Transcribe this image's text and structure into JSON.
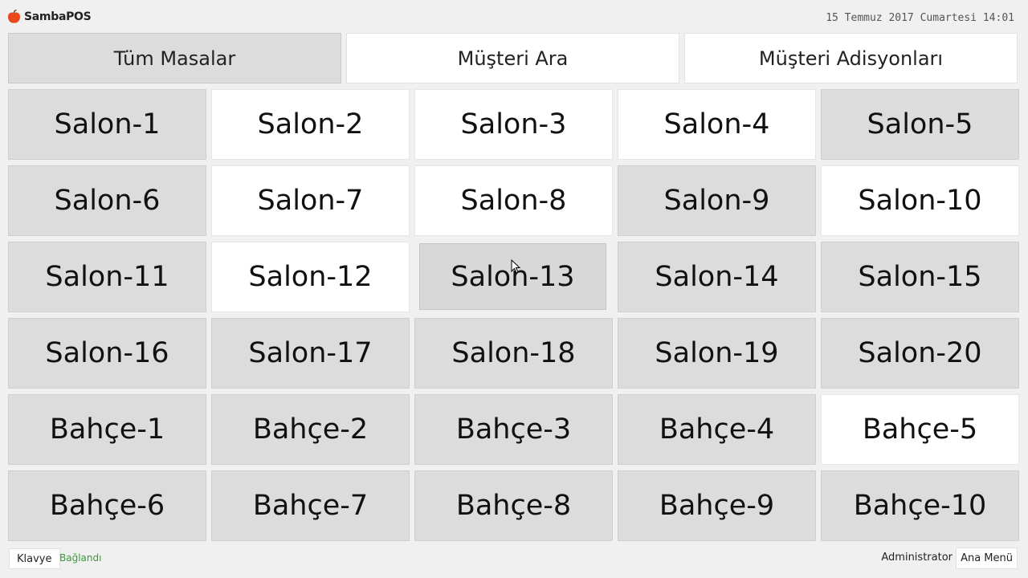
{
  "app": {
    "name": "SambaPOS",
    "datetime": "15 Temmuz 2017 Cumartesi 14:01",
    "logo_icon": "apple-logo-icon",
    "accent_color": "#e8481c"
  },
  "categories": [
    {
      "label": "Tüm Masalar",
      "state": "active"
    },
    {
      "label": "Müşteri Ara",
      "state": "inactive"
    },
    {
      "label": "Müşteri Adisyonları",
      "state": "inactive"
    }
  ],
  "tables": [
    {
      "label": "Salon-1",
      "state": "gray"
    },
    {
      "label": "Salon-2",
      "state": "white"
    },
    {
      "label": "Salon-3",
      "state": "white"
    },
    {
      "label": "Salon-4",
      "state": "white"
    },
    {
      "label": "Salon-5",
      "state": "gray"
    },
    {
      "label": "Salon-6",
      "state": "gray"
    },
    {
      "label": "Salon-7",
      "state": "white"
    },
    {
      "label": "Salon-8",
      "state": "white"
    },
    {
      "label": "Salon-9",
      "state": "gray"
    },
    {
      "label": "Salon-10",
      "state": "white"
    },
    {
      "label": "Salon-11",
      "state": "gray"
    },
    {
      "label": "Salon-12",
      "state": "white"
    },
    {
      "label": "Salon-13",
      "state": "hover"
    },
    {
      "label": "Salon-14",
      "state": "gray"
    },
    {
      "label": "Salon-15",
      "state": "gray"
    },
    {
      "label": "Salon-16",
      "state": "gray"
    },
    {
      "label": "Salon-17",
      "state": "gray"
    },
    {
      "label": "Salon-18",
      "state": "gray"
    },
    {
      "label": "Salon-19",
      "state": "gray"
    },
    {
      "label": "Salon-20",
      "state": "gray"
    },
    {
      "label": "Bahçe-1",
      "state": "gray"
    },
    {
      "label": "Bahçe-2",
      "state": "gray"
    },
    {
      "label": "Bahçe-3",
      "state": "gray"
    },
    {
      "label": "Bahçe-4",
      "state": "gray"
    },
    {
      "label": "Bahçe-5",
      "state": "white"
    },
    {
      "label": "Bahçe-6",
      "state": "gray"
    },
    {
      "label": "Bahçe-7",
      "state": "gray"
    },
    {
      "label": "Bahçe-8",
      "state": "gray"
    },
    {
      "label": "Bahçe-9",
      "state": "gray"
    },
    {
      "label": "Bahçe-10",
      "state": "gray"
    }
  ],
  "bottom": {
    "keyboard_label": "Klavye",
    "status": "Bağlandı",
    "status_color": "#3c9a3c",
    "user": "Administrator",
    "main_menu_label": "Ana Menü"
  }
}
